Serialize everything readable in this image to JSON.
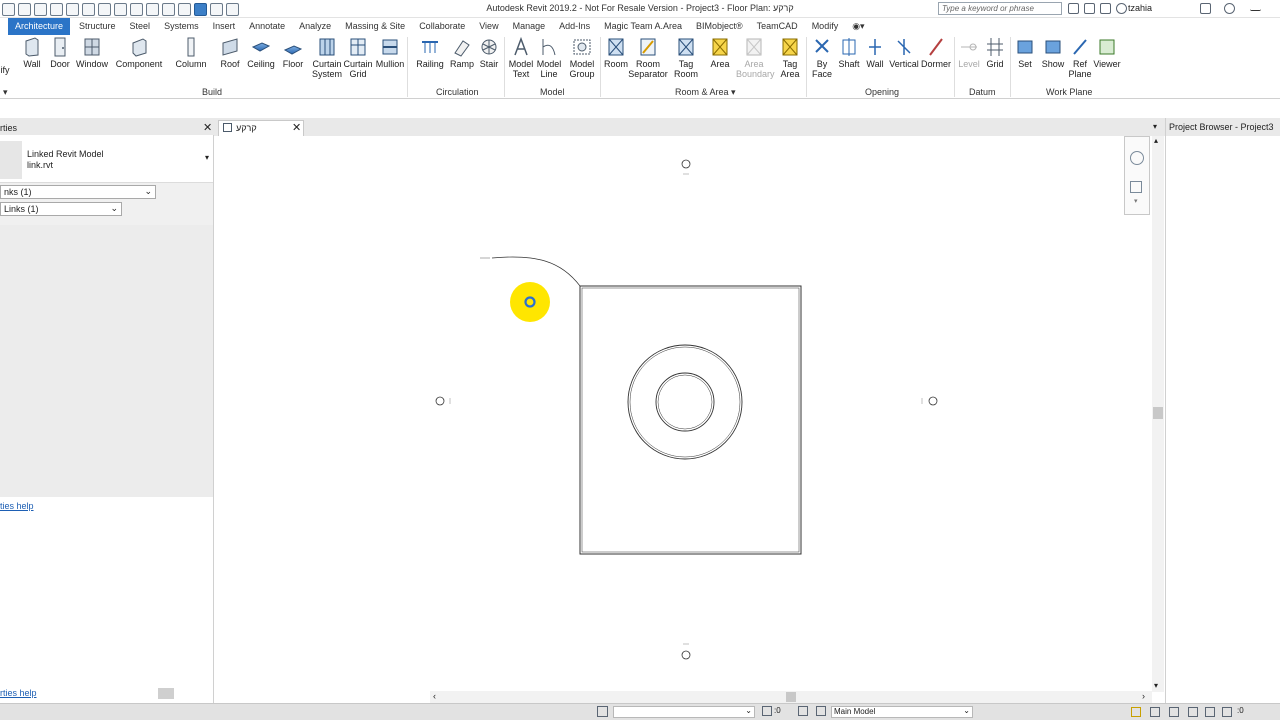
{
  "window": {
    "title": "Autodesk Revit 2019.2 - Not For Resale Version - Project3 - Floor Plan: קרקע",
    "search_placeholder": "Type a keyword or phrase",
    "user": "tzahia"
  },
  "menu_tabs": [
    "Architecture",
    "Structure",
    "Steel",
    "Systems",
    "Insert",
    "Annotate",
    "Analyze",
    "Massing & Site",
    "Collaborate",
    "View",
    "Manage",
    "Add-Ins",
    "Magic Team A.Area",
    "BIMobject®",
    "TeamCAD",
    "Modify"
  ],
  "active_tab": "Architecture",
  "ribbon": {
    "cut_label": "ify",
    "buttons": [
      {
        "label": "Wall"
      },
      {
        "label": "Door"
      },
      {
        "label": "Window"
      },
      {
        "label": "Component"
      },
      {
        "label": "Column"
      },
      {
        "label": "Roof"
      },
      {
        "label": "Ceiling"
      },
      {
        "label": "Floor"
      },
      {
        "label": "Curtain System"
      },
      {
        "label": "Curtain Grid"
      },
      {
        "label": "Mullion"
      },
      {
        "label": "Railing"
      },
      {
        "label": "Ramp"
      },
      {
        "label": "Stair"
      },
      {
        "label": "Model Text"
      },
      {
        "label": "Model Line"
      },
      {
        "label": "Model Group"
      },
      {
        "label": "Room"
      },
      {
        "label": "Room Separator"
      },
      {
        "label": "Tag Room"
      },
      {
        "label": "Area"
      },
      {
        "label": "Area Boundary"
      },
      {
        "label": "Tag Area"
      },
      {
        "label": "By Face"
      },
      {
        "label": "Shaft"
      },
      {
        "label": "Wall"
      },
      {
        "label": "Vertical"
      },
      {
        "label": "Dormer"
      },
      {
        "label": "Level"
      },
      {
        "label": "Grid"
      },
      {
        "label": "Set"
      },
      {
        "label": "Show"
      },
      {
        "label": "Ref Plane"
      },
      {
        "label": "Viewer"
      }
    ],
    "panels": [
      "Build",
      "Circulation",
      "Model",
      "Room & Area",
      "Opening",
      "Datum",
      "Work Plane"
    ]
  },
  "properties": {
    "title": "rties",
    "type_name": "Linked Revit Model",
    "type_file": "link.rvt",
    "filter": "nks (1)",
    "instance": "Links (1)",
    "help_link": "ties help",
    "help_link_bottom": "rties help"
  },
  "view_tab": {
    "label": "קרקע"
  },
  "project_browser": {
    "title": "Project Browser - Project3"
  },
  "statusbar": {
    "count_a": ":0",
    "model": "Main Model",
    "filter_count": ":0"
  },
  "colors": {
    "accent": "#2b74c7",
    "highlight": "#ffe600"
  }
}
